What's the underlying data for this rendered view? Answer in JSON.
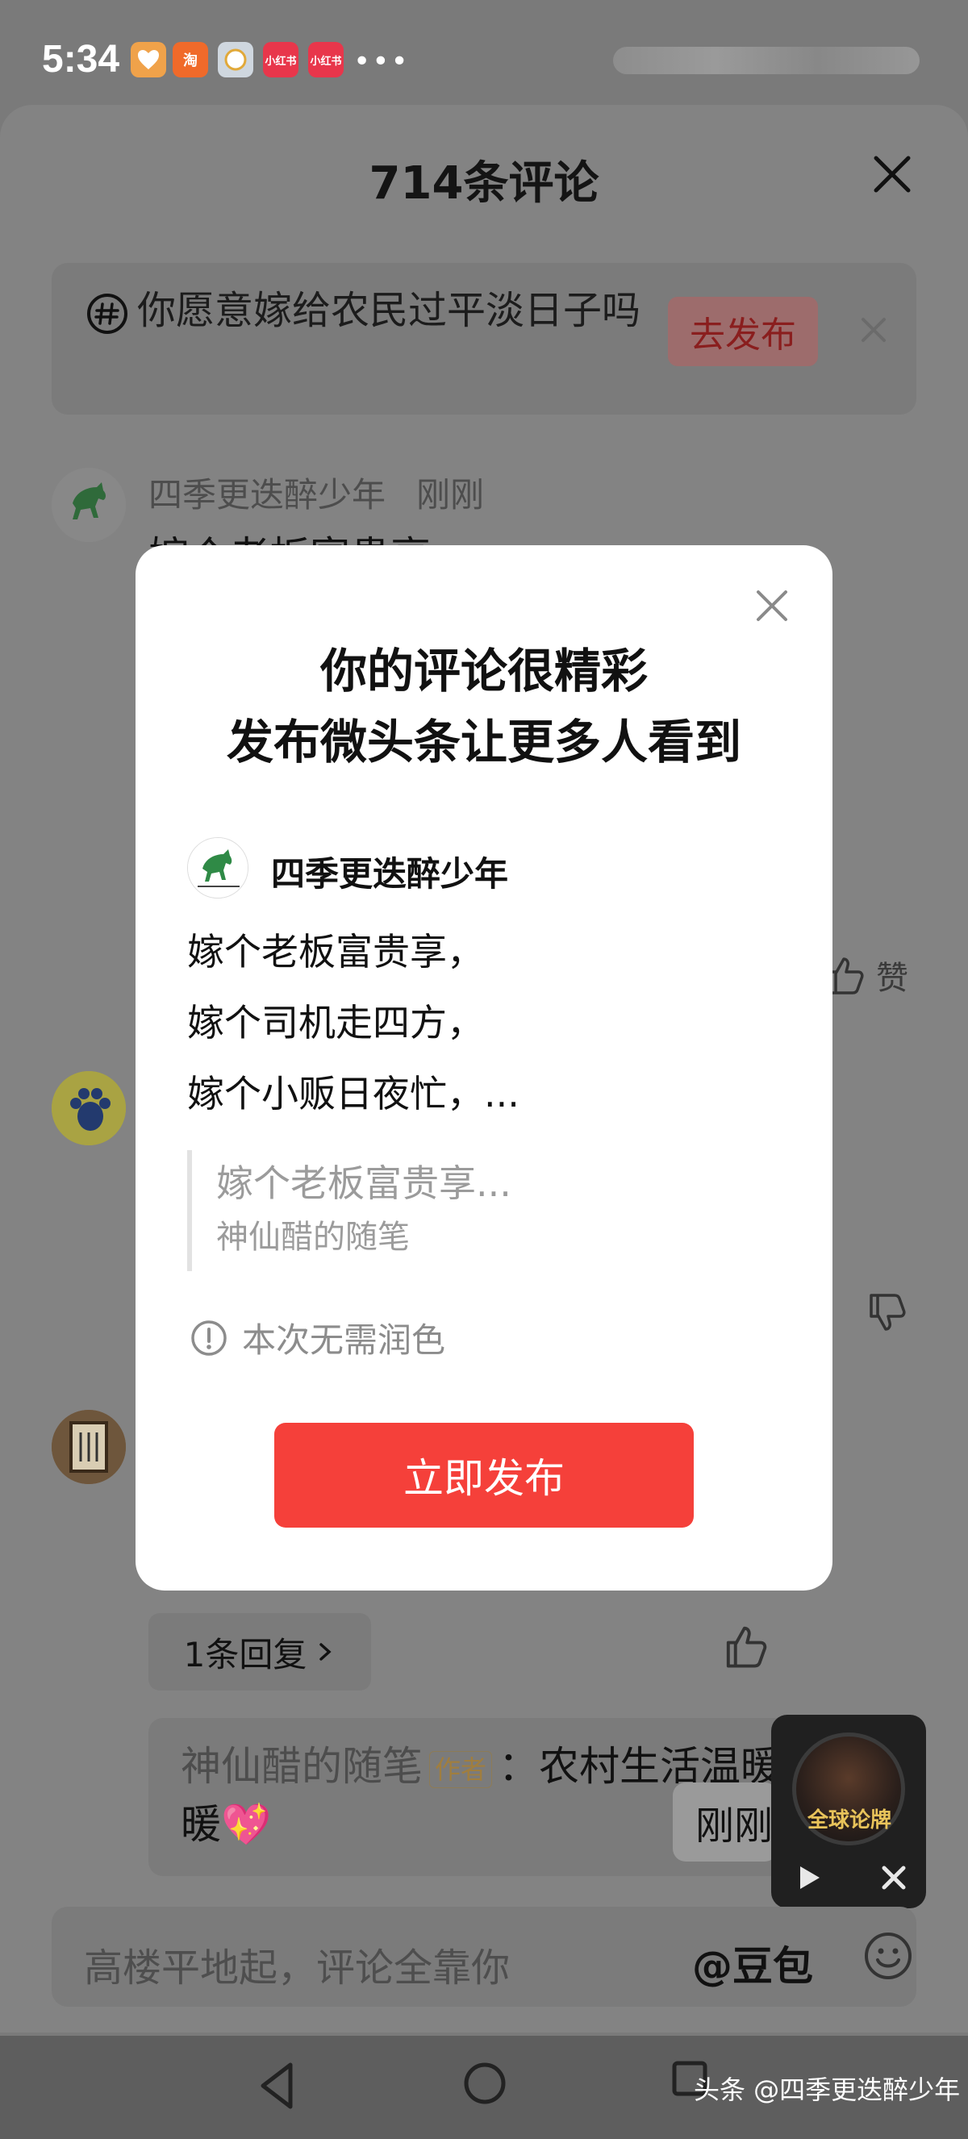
{
  "status_bar": {
    "time": "5:34",
    "more": "•••",
    "icons": [
      {
        "name": "app-icon-heart",
        "label": "",
        "color": "#f0a24a"
      },
      {
        "name": "app-icon-taobao",
        "label": "淘",
        "color": "#f06a2a"
      },
      {
        "name": "app-icon-round",
        "label": "",
        "color": "#cfd7df"
      },
      {
        "name": "app-icon-xiaohongshu",
        "label": "小红书",
        "color": "#e8364b"
      },
      {
        "name": "app-icon-xiaohongshu-2",
        "label": "小红书",
        "color": "#e8364b"
      }
    ]
  },
  "sheet": {
    "title": "714条评论"
  },
  "topic": {
    "text": "你愿意嫁给农民过平淡日子吗",
    "publish_label": "去发布"
  },
  "comment": {
    "user": "四季更迭醉少年",
    "time": "刚刚",
    "first_line": "嫁个老板富贵享"
  },
  "like_label": "赞",
  "reply": {
    "pill_label": "1条回复",
    "preview_user": "神仙醋的随笔",
    "author_tag": "作者",
    "preview_text": "：农村生活温暖",
    "preview_tail": "暖💖",
    "toast": "刚刚"
  },
  "mini_player": {
    "title": "全球论牌"
  },
  "input": {
    "placeholder": "高楼平地起，评论全靠你",
    "mention": "@豆包"
  },
  "watermark": "头条 @四季更迭醉少年",
  "modal": {
    "title_line1": "你的评论很精彩",
    "title_line2": "发布微头条让更多人看到",
    "author": "四季更迭醉少年",
    "lines": [
      "嫁个老板富贵享，",
      "嫁个司机走四方，",
      "嫁个小贩日夜忙，..."
    ],
    "quote_text": "嫁个老板富贵享...",
    "quote_source": "神仙醋的随笔",
    "notice": "本次无需润色",
    "publish_label": "立即发布"
  }
}
